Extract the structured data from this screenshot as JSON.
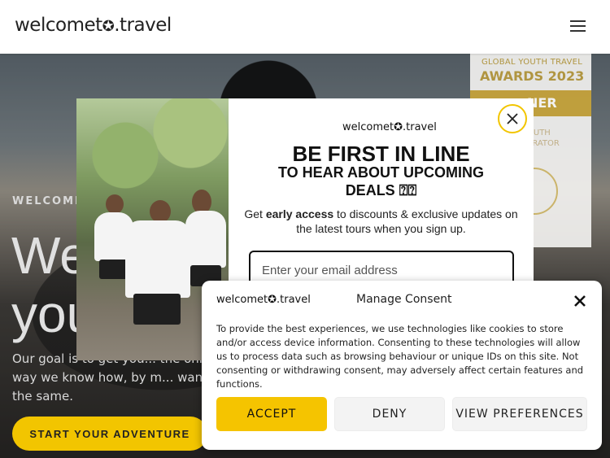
{
  "header": {
    "logo_prefix": "welcomet",
    "logo_globe": "✪",
    "logo_suffix": ".travel"
  },
  "hero": {
    "kicker": "WELCOME",
    "title": "We\nyou",
    "description": "Our goal is to get you... the only way we know how, by m... want the same.",
    "cta_label": "START YOUR ADVENTURE"
  },
  "award": {
    "line1": "GLOBAL YOUTH TRAVEL",
    "line2": "AWARDS 2023",
    "winner": "NER",
    "line3": "OUTH\nERATOR"
  },
  "popup": {
    "logo": "welcomet✪.travel",
    "headline": "BE FIRST IN LINE",
    "subheadline": "TO HEAR ABOUT UPCOMING DEALS ⍰⍰",
    "text_before": "Get ",
    "text_bold": "early access",
    "text_after": " to discounts & exclusive updates on the latest tours when you sign up.",
    "email_placeholder": "Enter your email address"
  },
  "consent": {
    "logo": "welcomet✪.travel",
    "title": "Manage Consent",
    "body": "To provide the best experiences, we use technologies like cookies to store and/or access device information. Consenting to these technologies will allow us to process data such as browsing behaviour or unique IDs on this site. Not consenting or withdrawing consent, may adversely affect certain features and functions.",
    "accept_label": "ACCEPT",
    "deny_label": "DENY",
    "prefs_label": "VIEW PREFERENCES"
  },
  "colors": {
    "accent": "#f5c400",
    "award_gold": "#c8a43a"
  },
  "icons": {
    "menu": "hamburger-icon",
    "close": "close-icon",
    "globe": "globe-icon"
  }
}
